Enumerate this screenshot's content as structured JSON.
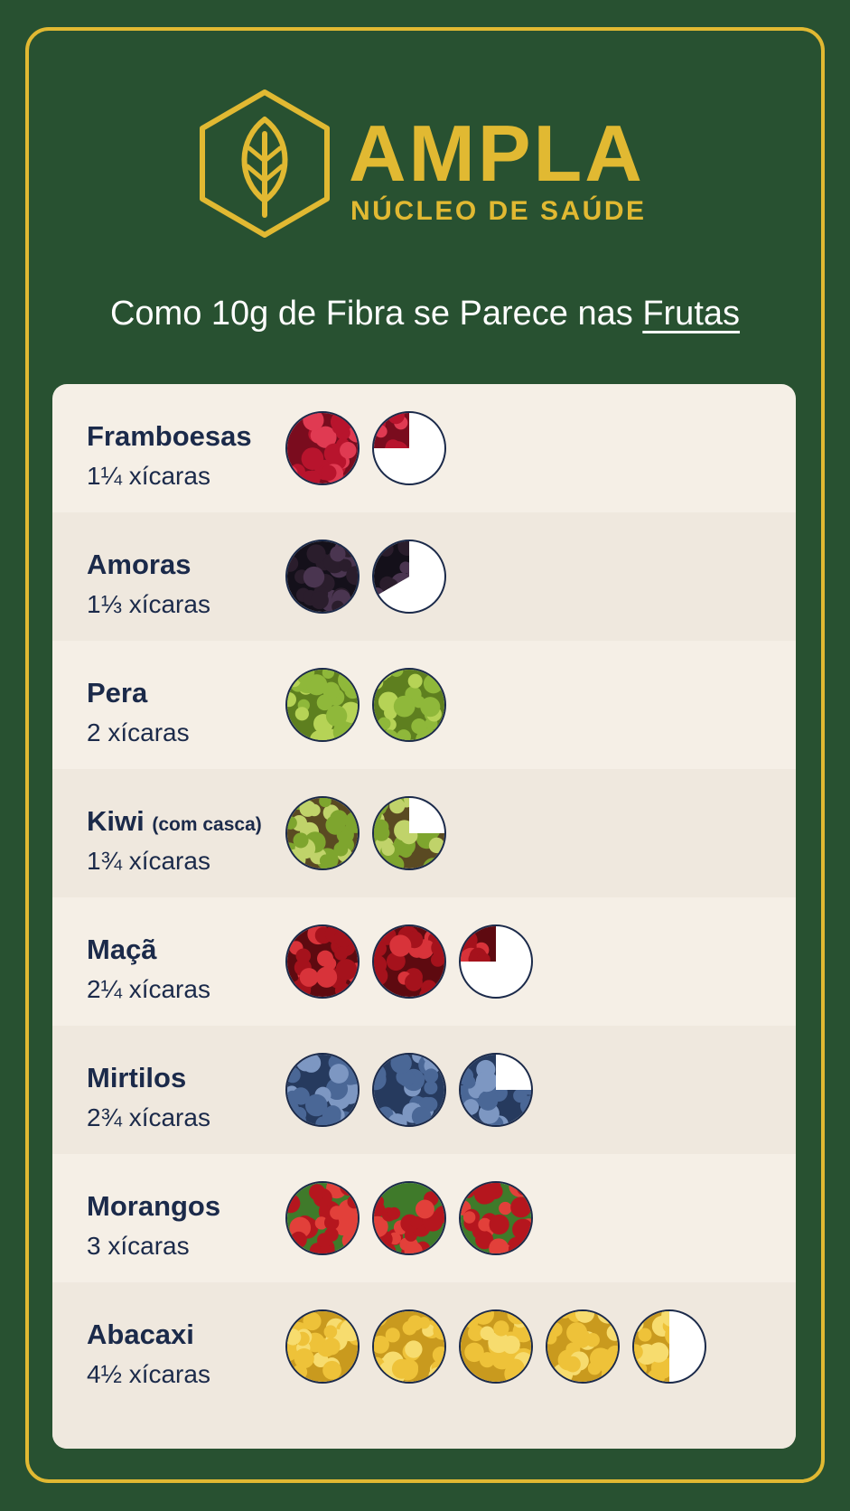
{
  "brand": {
    "name": "AMPLA",
    "subtitle": "NÚCLEO DE SAÚDE",
    "color": "#e1b932",
    "logo_icon": "leaf-icon"
  },
  "headline": {
    "prefix": "Como 10g de Fibra se Parece nas ",
    "emphasis": "Frutas"
  },
  "fruits": [
    {
      "name": "Framboesas",
      "note": "",
      "amount": "1¼ xícaras",
      "cups": 1.25,
      "colors": [
        "#b8142d",
        "#e03a52",
        "#7a0c1e"
      ]
    },
    {
      "name": "Amoras",
      "note": "",
      "amount": "1⅓ xícaras",
      "cups": 1.33,
      "colors": [
        "#2a1d2c",
        "#4a3550",
        "#14101a"
      ]
    },
    {
      "name": "Pera",
      "note": "",
      "amount": "2 xícaras",
      "cups": 2,
      "colors": [
        "#8fb83a",
        "#b6d356",
        "#5e7f1f"
      ]
    },
    {
      "name": "Kiwi",
      "note": "(com casca)",
      "amount": "1¾ xícaras",
      "cups": 1.75,
      "colors": [
        "#7ea52e",
        "#c0d36a",
        "#5a4a22"
      ]
    },
    {
      "name": "Maçã",
      "note": "",
      "amount": "2¼ xícaras",
      "cups": 2.25,
      "colors": [
        "#a5121c",
        "#d8333a",
        "#5e0a10"
      ]
    },
    {
      "name": "Mirtilos",
      "note": "",
      "amount": "2¾ xícaras",
      "cups": 2.75,
      "colors": [
        "#4a6796",
        "#7d97c2",
        "#263a5e"
      ]
    },
    {
      "name": "Morangos",
      "note": "",
      "amount": "3 xícaras",
      "cups": 3,
      "colors": [
        "#b5161e",
        "#e2403a",
        "#3f7a2a"
      ]
    },
    {
      "name": "Abacaxi",
      "note": "",
      "amount": "4½ xícaras",
      "cups": 4.5,
      "colors": [
        "#eec239",
        "#f7dc6e",
        "#c99a1e"
      ]
    }
  ]
}
